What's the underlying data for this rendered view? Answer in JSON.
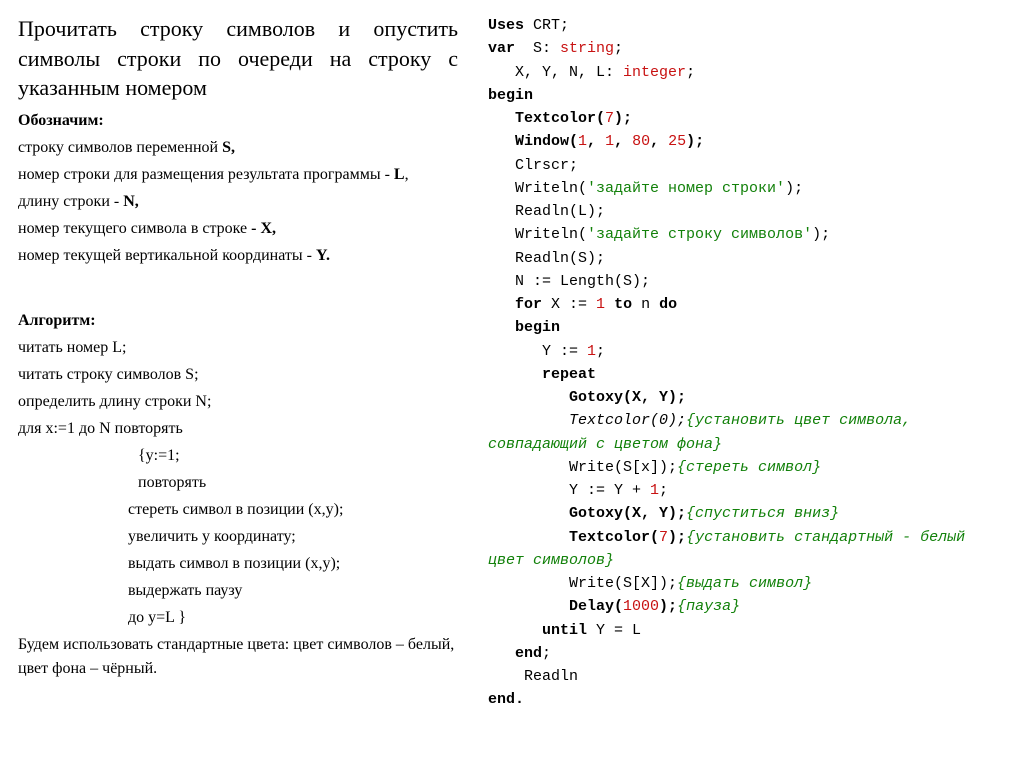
{
  "left": {
    "title": "Прочитать строку символов и опустить символы строки по очереди на строку с указанным номером",
    "designate_heading": "Обозначим:",
    "d1a": "строку символов переменной ",
    "d1b": "S,",
    "d2a": "номер строки для размещения результата программы - ",
    "d2b": "L",
    "d3a": "длину строки - ",
    "d3b": "N,",
    "d4a": "номер текущего символа в строке ",
    "d4b": "- X,",
    "d5a": " номер текущей вертикальной координаты - ",
    "d5b": "Y.",
    "alg_heading": "Алгоритм:",
    "a1": "читать номер L;",
    "a2": "читать строку символов S;",
    "a3": " определить длину строки N;",
    "a4": " для x:=1 до N повторять",
    "a5": "{y:=1;",
    "a6": " повторять",
    "a7": "стереть символ в позиции (x,y);",
    "a8": "увеличить y координату;",
    "a9": "выдать символ в позиции (x,y);",
    "a10": "выдержать паузу",
    "a11": "до y=L }",
    "footer": "Будем использовать стандартные цвета: цвет символов – белый, цвет фона – чёрный."
  },
  "code": {
    "uses": "Uses",
    "crt": " CRT;",
    "var": "var",
    "sdecl": "  S: ",
    "string": "string",
    "semi": ";",
    "xyn1": "   X, Y, N, L: ",
    "integer": "integer",
    "begin": "begin",
    "textcolor": "   Textcolor(",
    "seven": "7",
    "closeparen": ");",
    "window": "   Window(",
    "one": "1",
    "comma": ", ",
    "eighty": "80",
    "twentyfive": "25",
    "clrscr": "   Clrscr;",
    "writeln1a": "   Writeln(",
    "str1": "'задайте номер строки'",
    "readlnL": "   Readln(L);",
    "str2": "'задайте строку символов'",
    "readlnS": "   Readln(S);",
    "nlen": "   N := Length(S);",
    "for": "for",
    "xassign": " X := ",
    "to": "to",
    "ndo": " n ",
    "do": "do",
    "begin2": "   begin",
    "yassign": "      Y := ",
    "repeat": "repeat",
    "gotoxy1": "         Gotoxy(X, Y);",
    "textcolor0a": "         ",
    "textcolor0fn": "Textcolor(0);",
    "cmt1": "{установить цвет символа, совпадающий с цветом фона}",
    "writesx1": "         Write(S[x]);",
    "cmt2": "{стереть символ}",
    "yinc": "         Y := Y + ",
    "gotoxy2a": "         Gotoxy(X, Y);",
    "cmt3": "{спуститься вниз}",
    "textcolor7a": "         Textcolor(",
    "cmt4": "{установить стандартный - белый цвет символов}",
    "writesx2": "         Write(S[X]);",
    "cmt5": "{выдать символ}",
    "delay": "         Delay(",
    "thousand": "1000",
    "cmt6": "{пауза}",
    "until": "until",
    "untilcond": " Y = L",
    "end": "end",
    "readln": "    Readln",
    "enddot": "end."
  }
}
